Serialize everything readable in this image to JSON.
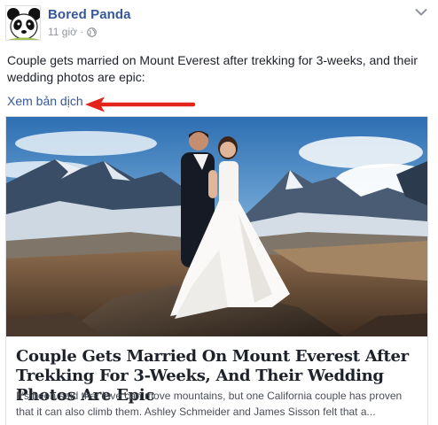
{
  "header": {
    "page_name": "Bored Panda",
    "time": "11 giờ",
    "separator": "·",
    "audience_icon": "globe-icon",
    "menu_icon": "chevron-down-icon",
    "avatar_icon": "panda-logo"
  },
  "post": {
    "text": "Couple gets married on Mount Everest after trekking for 3-weeks, and their wedding photos are epic:",
    "translate_link": "Xem bản dịch"
  },
  "annotation": {
    "arrow_color": "#e3241b"
  },
  "card": {
    "image_alt": "Wedding couple standing on a rock with snowy Himalayan mountains behind",
    "title": "Couple Gets Married On Mount Everest After Trekking For 3-Weeks, And Their Wedding Photos Are Epic",
    "description": "It's been said that love can move mountains, but one California couple has proven that it can also climb them. Ashley Schmeider and James Sisson felt that a..."
  },
  "colors": {
    "link": "#365899",
    "meta": "#90949c",
    "text": "#1d2129",
    "border": "#dddfe2"
  }
}
